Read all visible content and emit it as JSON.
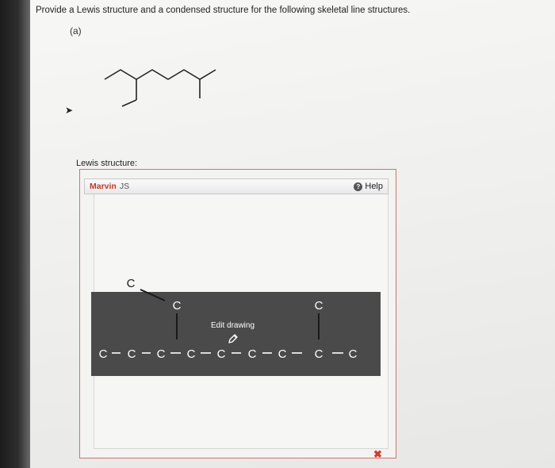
{
  "question": {
    "instructions": "Provide a Lewis structure and a condensed structure for the following skeletal line structures.",
    "part_label": "(a)"
  },
  "answer": {
    "lewis_label": "Lewis structure:",
    "editor": {
      "title": "Marvin",
      "title_suffix": "JS",
      "help_label": "Help",
      "overlay_label": "Edit drawing",
      "atom_symbol": "C",
      "remove_symbol": "✖"
    }
  },
  "colors": {
    "accent_red": "#c0392b",
    "overlay_dark": "#4a4a4a"
  },
  "icons": [
    "help-icon",
    "edit-pen-icon",
    "remove-icon",
    "cursor-arrow-icon"
  ]
}
